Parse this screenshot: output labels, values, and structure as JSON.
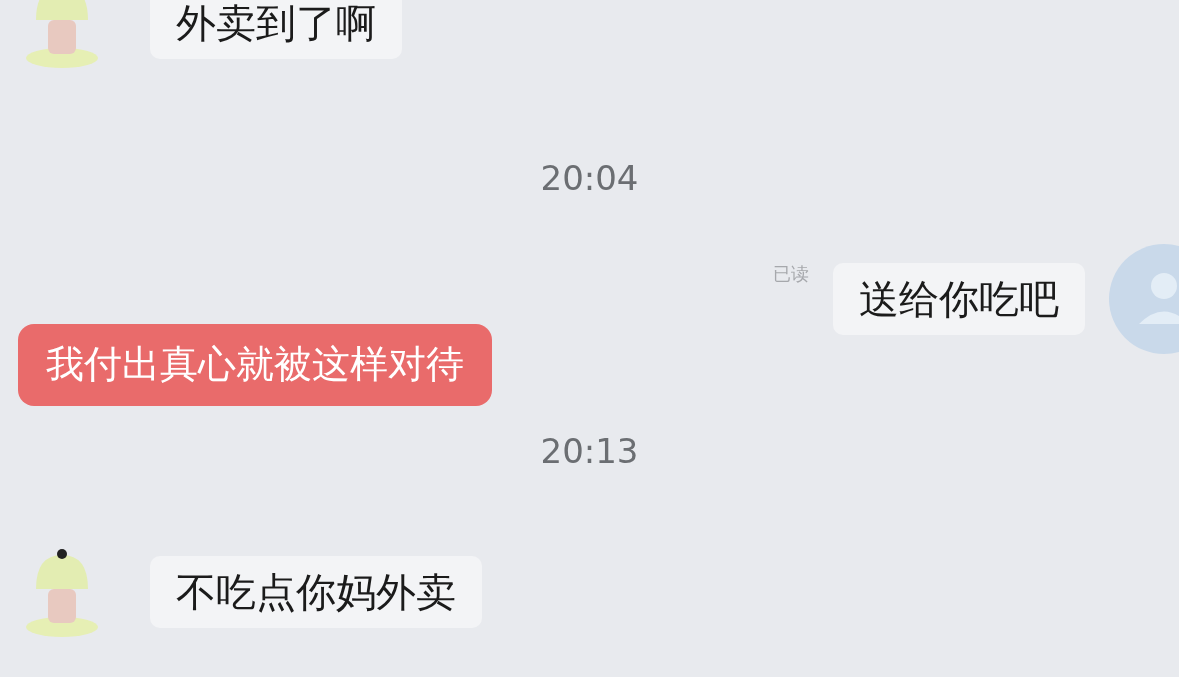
{
  "messages": [
    {
      "kind": "incoming",
      "text": "外卖到了啊"
    },
    {
      "kind": "time",
      "text": "20:04"
    },
    {
      "kind": "outgoing",
      "text": "送给你吃吧",
      "status": "已读"
    },
    {
      "kind": "caption",
      "text": "我付出真心就被这样对待"
    },
    {
      "kind": "time",
      "text": "20:13"
    },
    {
      "kind": "incoming",
      "text": "不吃点你妈外卖"
    }
  ]
}
